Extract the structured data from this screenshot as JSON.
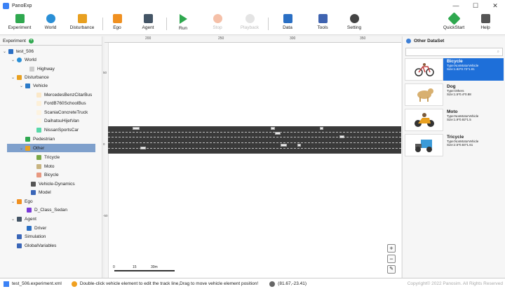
{
  "app": {
    "title": "PanoExp"
  },
  "window_controls": [
    "—",
    "☐",
    "✕"
  ],
  "toolbar": {
    "experiment": "Experiment",
    "world": "World",
    "disturbance": "Disturbance",
    "ego": "Ego",
    "agent": "Agent",
    "run": "Run",
    "stop": "Stop",
    "playback": "Playback",
    "data": "Data",
    "tools": "Tools",
    "setting": "Setting",
    "quickstart": "QuickStart",
    "help": "Help"
  },
  "left_panel": {
    "title": "Experiment",
    "tree": {
      "test": "test_506",
      "world": "World",
      "highway": "Highway",
      "disturbance": "Disturbance",
      "vehicle": "Vehicle",
      "v1": "MercedesBenzCitarBus",
      "v2": "FordB760SchoolBus",
      "v3": "ScaniaConcreteTruck",
      "v4": "DaihatsuHijetVan",
      "v5": "NissanSportsCar",
      "pedestrian": "Pedestrian",
      "other": "Other",
      "o1": "Tricycle",
      "o2": "Moto",
      "o3": "Bicycle",
      "vd": "Vehicle-Dynamics",
      "model": "Model",
      "ego": "Ego",
      "ego_car": "D_Class_Sedan",
      "agent": "Agent",
      "driver": "Driver",
      "simulation": "Simulation",
      "globals": "GlobalVariables"
    }
  },
  "canvas": {
    "ruler_x": [
      "200",
      "250",
      "300",
      "350"
    ],
    "ruler_y": [
      "50",
      "0",
      "-50"
    ],
    "scale": {
      "a": "0",
      "b": "15",
      "c": "30m"
    },
    "zoom_in": "+",
    "zoom_out": "−"
  },
  "right_panel": {
    "title": "Other DataSet",
    "items": [
      {
        "name": "Bicycle",
        "type": "Type:NonMotorVehicle",
        "size": "Size:1.82*0.72*1.81"
      },
      {
        "name": "Dog",
        "type": "Type:Others",
        "size": "Size:1.5*0.4*0.88"
      },
      {
        "name": "Moto",
        "type": "Type:NonMotorVehicle",
        "size": "Size:1.9*0.92*1.5"
      },
      {
        "name": "Tricycle",
        "type": "Type:NonMotorVehicle",
        "size": "Size:2.5*0.84*1.61"
      }
    ]
  },
  "status": {
    "file": "test_506.experiment.xml",
    "hint": "Double-click vehicle element to edit the track line,Drag to move vehicle element position!",
    "coords": "(81.67,-23.41)",
    "copyright": "Copyright© 2022 Panosim. All Rights Reserved"
  }
}
